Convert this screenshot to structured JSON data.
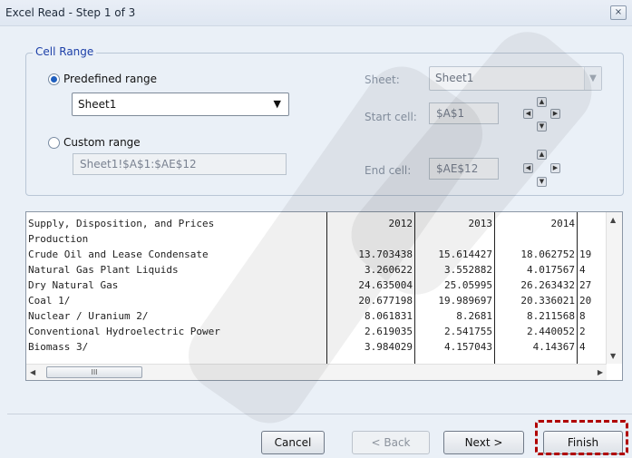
{
  "window": {
    "title": "Excel Read - Step 1 of 3",
    "close_glyph": "⨯"
  },
  "cell_range": {
    "legend": "Cell Range",
    "predefined_label": "Predefined range",
    "predefined_value": "Sheet1",
    "custom_label": "Custom range",
    "custom_value": "Sheet1!$A$1:$AE$12",
    "selected": "predefined"
  },
  "sheet_panel": {
    "sheet_label": "Sheet:",
    "sheet_value": "Sheet1",
    "start_label": "Start cell:",
    "start_value": "$A$1",
    "end_label": "End cell:",
    "end_value": "$AE$12"
  },
  "preview": {
    "columns": [
      "Supply, Disposition, and Prices",
      "2012",
      "2013",
      "2014",
      ""
    ],
    "rows": [
      [
        "Production",
        "",
        "",
        "",
        ""
      ],
      [
        "   Crude Oil and Lease Condensate",
        "13.703438",
        "15.614427",
        "18.062752",
        "19"
      ],
      [
        "   Natural Gas Plant Liquids",
        "3.260622",
        "3.552882",
        "4.017567",
        "4"
      ],
      [
        "   Dry Natural Gas",
        "24.635004",
        "25.05995",
        "26.263432",
        "27"
      ],
      [
        "   Coal 1/",
        "20.677198",
        "19.989697",
        "20.336021",
        "20"
      ],
      [
        "   Nuclear / Uranium 2/",
        "8.061831",
        "8.2681",
        "8.211568",
        "8"
      ],
      [
        "   Conventional Hydroelectric Power",
        "2.619035",
        "2.541755",
        "2.440052",
        "2"
      ],
      [
        "   Biomass 3/",
        "3.984029",
        "4.157043",
        "4.14367",
        "4"
      ]
    ],
    "scroll_thumb_glyph": "III"
  },
  "buttons": {
    "cancel": "Cancel",
    "back": "< Back",
    "next": "Next >",
    "finish": "Finish"
  },
  "icons": {
    "radio": "radio-button",
    "dropdown": "chevron-down-icon",
    "nudge": "arrow-nudge-icon"
  }
}
